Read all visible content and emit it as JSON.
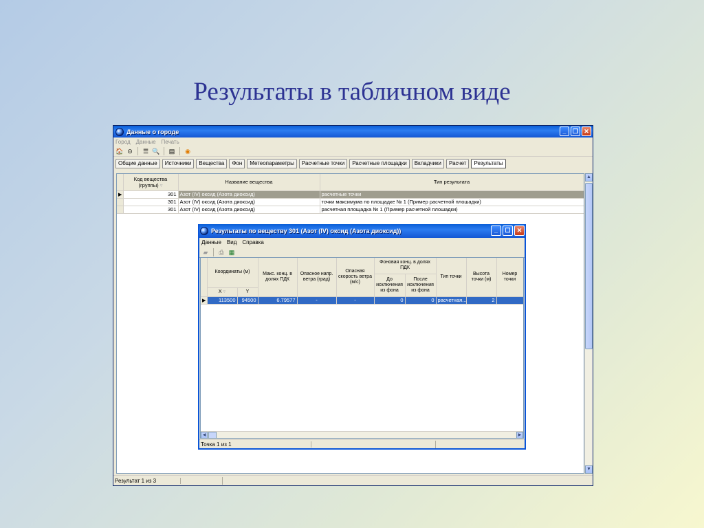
{
  "slide": {
    "title": "Результаты в табличном виде"
  },
  "main_window": {
    "title": "Данные о городе",
    "menu": [
      "Город",
      "Данные",
      "Печать"
    ],
    "tabs": [
      "Общие данные",
      "Источники",
      "Вещества",
      "Фон",
      "Метеопараметры",
      "Расчетные точки",
      "Расчетные площадки",
      "Вкладчики",
      "Расчет",
      "Результаты"
    ],
    "active_tab": "Результаты",
    "grid": {
      "headers": {
        "code": "Код вещества (группы)",
        "name": "Название вещества",
        "type": "Тип результата"
      },
      "rows": [
        {
          "code": "301",
          "name": "Азот (IV) оксид (Азота диоксид)",
          "type": "расчетные точки"
        },
        {
          "code": "301",
          "name": "Азот (IV) оксид (Азота диоксид)",
          "type": "точки максимума по площадке № 1 (Пример расчетной плошадки)"
        },
        {
          "code": "301",
          "name": "Азот (IV) оксид (Азота диоксид)",
          "type": "расчетная площадка № 1 (Пример расчетной плошадки)"
        }
      ]
    },
    "status": "Результат 1 из 3"
  },
  "sub_window": {
    "title": "Результаты по веществу 301 (Азот (IV) оксид (Азота диоксид))",
    "menu": [
      "Данные",
      "Вид",
      "Справка"
    ],
    "headers": {
      "coords": "Координаты (м)",
      "x": "X",
      "y": "Y",
      "max_conc": "Макс. конц. в долях ПДК",
      "danger_dir": "Опасное напр. ветра (град)",
      "danger_speed": "Опасная скорость ветра (м/с)",
      "background": "Фоновая конц. в долях ПДК",
      "bg_before": "До исключения из фона",
      "bg_after": "После исключения из фона",
      "point_type": "Тип точки",
      "height": "Высота точки (м)",
      "number": "Номер точки"
    },
    "rows": [
      {
        "x": "113500",
        "y": "94500",
        "max_conc": "6.79577",
        "danger_dir": "-",
        "danger_speed": "-",
        "bg_before": "0",
        "bg_after": "0",
        "point_type": "расчетная...",
        "height": "2",
        "number": ""
      }
    ],
    "status": "Точка 1 из 1"
  }
}
